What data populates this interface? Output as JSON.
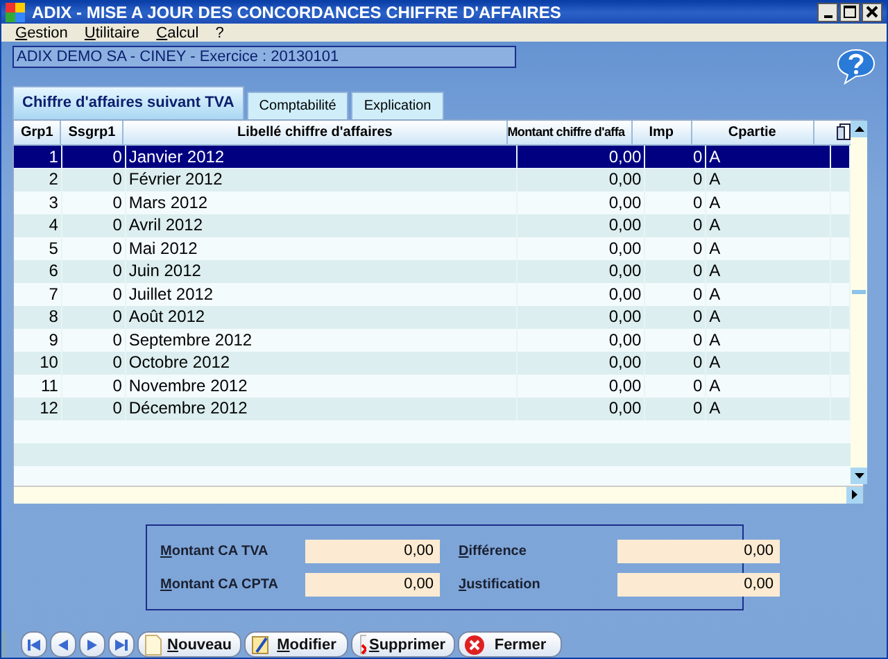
{
  "window": {
    "title": "ADIX - MISE A JOUR DES CONCORDANCES CHIFFRE D'AFFAIRES"
  },
  "menu": [
    {
      "label": "Gestion",
      "accelerator": true
    },
    {
      "label": "Utilitaire",
      "accelerator": true
    },
    {
      "label": "Calcul",
      "accelerator": true
    },
    {
      "label": "?",
      "accelerator": false
    }
  ],
  "info_bar": "ADIX DEMO SA  - CINEY - Exercice : 20130101",
  "tabs": [
    {
      "label": "Chiffre d'affaires suivant TVA",
      "selected": true
    },
    {
      "label": "Comptabilité",
      "selected": false
    },
    {
      "label": "Explication",
      "selected": false
    }
  ],
  "table": {
    "columns": [
      "Grp1",
      "Ssgrp1",
      "Libellé chiffre d'affaires",
      "Montant chiffre d'affa",
      "Imp",
      "Cpartie"
    ],
    "rows": [
      {
        "cells": [
          "1",
          "0",
          "Janvier 2012",
          "0,00",
          "0",
          "A"
        ],
        "selected": true
      },
      {
        "cells": [
          "2",
          "0",
          "Février 2012",
          "0,00",
          "0",
          "A"
        ],
        "selected": false
      },
      {
        "cells": [
          "3",
          "0",
          "Mars 2012",
          "0,00",
          "0",
          "A"
        ],
        "selected": false
      },
      {
        "cells": [
          "4",
          "0",
          "Avril 2012",
          "0,00",
          "0",
          "A"
        ],
        "selected": false
      },
      {
        "cells": [
          "5",
          "0",
          "Mai 2012",
          "0,00",
          "0",
          "A"
        ],
        "selected": false
      },
      {
        "cells": [
          "6",
          "0",
          "Juin 2012",
          "0,00",
          "0",
          "A"
        ],
        "selected": false
      },
      {
        "cells": [
          "7",
          "0",
          "Juillet 2012",
          "0,00",
          "0",
          "A"
        ],
        "selected": false
      },
      {
        "cells": [
          "8",
          "0",
          "Août 2012",
          "0,00",
          "0",
          "A"
        ],
        "selected": false
      },
      {
        "cells": [
          "9",
          "0",
          "Septembre 2012",
          "0,00",
          "0",
          "A"
        ],
        "selected": false
      },
      {
        "cells": [
          "10",
          "0",
          "Octobre 2012",
          "0,00",
          "0",
          "A"
        ],
        "selected": false
      },
      {
        "cells": [
          "11",
          "0",
          "Novembre 2012",
          "0,00",
          "0",
          "A"
        ],
        "selected": false
      },
      {
        "cells": [
          "12",
          "0",
          "Décembre 2012",
          "0,00",
          "0",
          "A"
        ],
        "selected": false
      }
    ]
  },
  "summary": [
    {
      "label": "Montant CA TVA",
      "value": "0,00"
    },
    {
      "label": "Différence",
      "value": "0,00"
    },
    {
      "label": "Montant CA CPTA",
      "value": "0,00"
    },
    {
      "label": "Justification",
      "value": "0,00"
    }
  ],
  "toolbar": {
    "nav": [
      {
        "kind": "first"
      },
      {
        "kind": "prev"
      },
      {
        "kind": "next"
      },
      {
        "kind": "last"
      }
    ],
    "buttons": [
      {
        "kind": "new",
        "label": "Nouveau",
        "accelerator": true
      },
      {
        "kind": "edit",
        "label": "Modifier",
        "accelerator": true
      },
      {
        "kind": "delete",
        "label": "Supprimer",
        "accelerator": true
      },
      {
        "kind": "close",
        "label": "Fermer",
        "accelerator": false
      }
    ]
  }
}
